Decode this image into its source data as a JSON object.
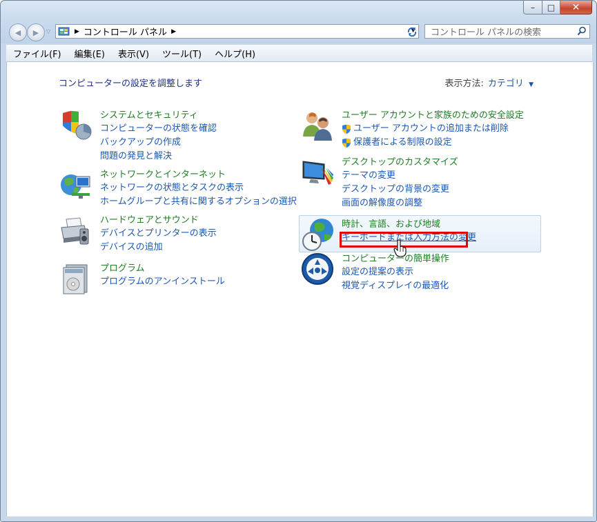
{
  "window": {
    "caption_buttons": {
      "minimize": "–",
      "maximize": "□",
      "close": "✕"
    }
  },
  "address_bar": {
    "breadcrumb": "コントロール パネル",
    "search_placeholder": "コントロール パネルの検索"
  },
  "menu": [
    "ファイル(F)",
    "編集(E)",
    "表示(V)",
    "ツール(T)",
    "ヘルプ(H)"
  ],
  "main": {
    "heading": "コンピューターの設定を調整します",
    "view_by_label": "表示方法:",
    "view_by_value": "カテゴリ"
  },
  "categories_left": [
    {
      "icon": "shield-icon",
      "title": "システムとセキュリティ",
      "links": [
        "コンピューターの状態を確認",
        "バックアップの作成",
        "問題の発見と解決"
      ]
    },
    {
      "icon": "network-globe-icon",
      "title": "ネットワークとインターネット",
      "links": [
        "ネットワークの状態とタスクの表示",
        "ホームグループと共有に関するオプションの選択"
      ]
    },
    {
      "icon": "printer-icon",
      "title": "ハードウェアとサウンド",
      "links": [
        "デバイスとプリンターの表示",
        "デバイスの追加"
      ]
    },
    {
      "icon": "programs-icon",
      "title": "プログラム",
      "links": [
        "プログラムのアンインストール"
      ]
    }
  ],
  "categories_right": [
    {
      "icon": "users-icon",
      "title": "ユーザー アカウントと家族のための安全設定",
      "links": [
        "ユーザー アカウントの追加または削除",
        "保護者による制限の設定"
      ]
    },
    {
      "icon": "desktop-icon",
      "title": "デスクトップのカスタマイズ",
      "links": [
        "テーマの変更",
        "デスクトップの背景の変更",
        "画面の解像度の調整"
      ]
    },
    {
      "icon": "clock-globe-icon",
      "title": "時計、言語、および地域",
      "links": [
        "キーボードまたは入力方法の変更"
      ]
    },
    {
      "icon": "ease-of-access-icon",
      "title": "コンピューターの簡単操作",
      "links": [
        "設定の提案の表示",
        "視覚ディスプレイの最適化"
      ]
    }
  ],
  "colors": {
    "category_title": "#1f7c23",
    "link": "#1c58b3",
    "highlight_box": "#e00000"
  }
}
